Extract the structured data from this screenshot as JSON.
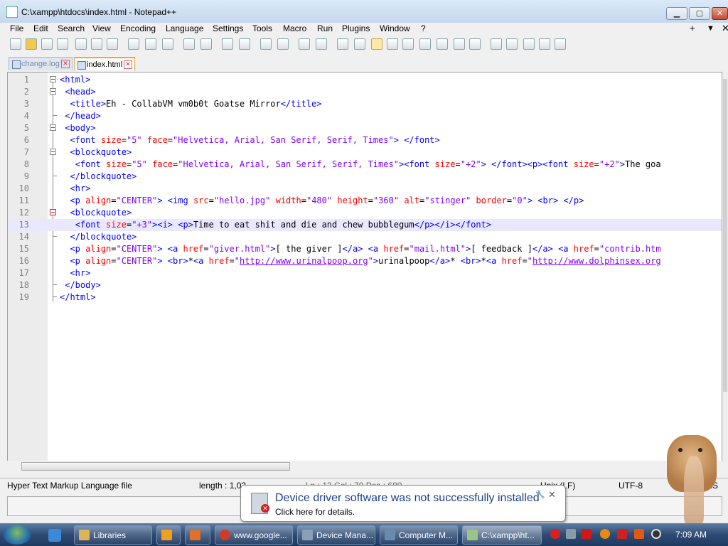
{
  "window": {
    "title": "C:\\xampp\\htdocs\\index.html - Notepad++",
    "minimize": "▁",
    "maximize": "▢",
    "close": "✕"
  },
  "menu": {
    "items": [
      "File",
      "Edit",
      "Search",
      "View",
      "Encoding",
      "Language",
      "Settings",
      "Tools",
      "Macro",
      "Run",
      "Plugins",
      "Window",
      "?"
    ],
    "right": [
      "+",
      "▼",
      "✕"
    ]
  },
  "tabs": [
    {
      "label": "change.log",
      "active": false
    },
    {
      "label": "index.html",
      "active": true
    }
  ],
  "editor": {
    "line_numbers": [
      "1",
      "2",
      "3",
      "4",
      "5",
      "6",
      "7",
      "8",
      "9",
      "10",
      "11",
      "12",
      "13",
      "14",
      "15",
      "16",
      "17",
      "18",
      "19"
    ],
    "lines": [
      "<html>",
      " <head>",
      "  <title>Eh - CollabVM vm0b0t Goatse Mirror</title>",
      " </head>",
      " <body>",
      "  <font size=\"5\" face=\"Helvetica, Arial, San Serif, Serif, Times\"> </font>",
      "  <blockquote>",
      "   <font size=\"5\" face=\"Helvetica, Arial, San Serif, Serif, Times\"><font size=\"+2\"> </font><p><font size=\"+2\">The goa",
      "  </blockquote>",
      "  <hr>",
      "  <p align=\"CENTER\"> <img src=\"hello.jpg\" width=\"480\" height=\"360\" alt=\"stinger\" border=\"0\"> <br> </p>",
      "  <blockquote>",
      "   <font size=\"+3\"><i> <p>Time to eat shit and die and chew bubblegum</p></i></font>",
      "  </blockquote>",
      "  <p align=\"CENTER\"> <a href=\"giver.html\">[ the giver ]</a> <a href=\"mail.html\">[ feedback ]</a> <a href=\"contrib.htm",
      "  <p align=\"CENTER\"> <br>*<a href=\"http://www.urinalpoop.org\">urinalpoop</a>* <br>*<a href=\"http://www.dolphinsex.org",
      "  <hr>",
      " </body>",
      "</html>"
    ],
    "current_line": 13
  },
  "status": {
    "file_type": "Hyper Text Markup Language file",
    "length": "length : 1,02",
    "position": "Ln : 13    Col : 70    Pos : 680",
    "eol": "Unix (LF)",
    "encoding": "UTF-8",
    "ins": "INS"
  },
  "notification": {
    "title": "Device driver software was not successfully installed",
    "subtitle": "Click here for details.",
    "close": "✕"
  },
  "taskbar": {
    "buttons": [
      "Libraries",
      "www.google...",
      "Device Mana...",
      "Computer M...",
      "C:\\xampp\\ht..."
    ],
    "clock": "7:09 AM"
  },
  "colors": {
    "tag": "#0000ff",
    "attr": "#ff0000",
    "value": "#8000ff",
    "current_line": "#e8e8ff"
  }
}
